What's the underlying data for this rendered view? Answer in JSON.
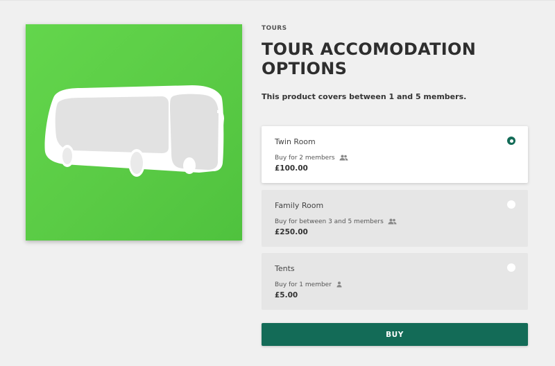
{
  "product": {
    "category": "TOURS",
    "title": "TOUR ACCOMODATION OPTIONS",
    "description": "This product covers between 1 and 5 members.",
    "image_icon": "bus-icon",
    "image_background": "#5acb45"
  },
  "options": [
    {
      "name": "Twin Room",
      "members": "Buy for 2 members",
      "members_icon": "group-icon",
      "price": "£100.00",
      "selected": true
    },
    {
      "name": "Family Room",
      "members": "Buy for between 3 and 5 members",
      "members_icon": "group-icon",
      "price": "£250.00",
      "selected": false
    },
    {
      "name": "Tents",
      "members": "Buy for 1 member",
      "members_icon": "person-icon",
      "price": "£5.00",
      "selected": false
    }
  ],
  "actions": {
    "buy_label": "BUY"
  },
  "colors": {
    "accent": "#136b57",
    "selected_card": "#ffffff",
    "unselected_card": "#e6e6e6"
  }
}
